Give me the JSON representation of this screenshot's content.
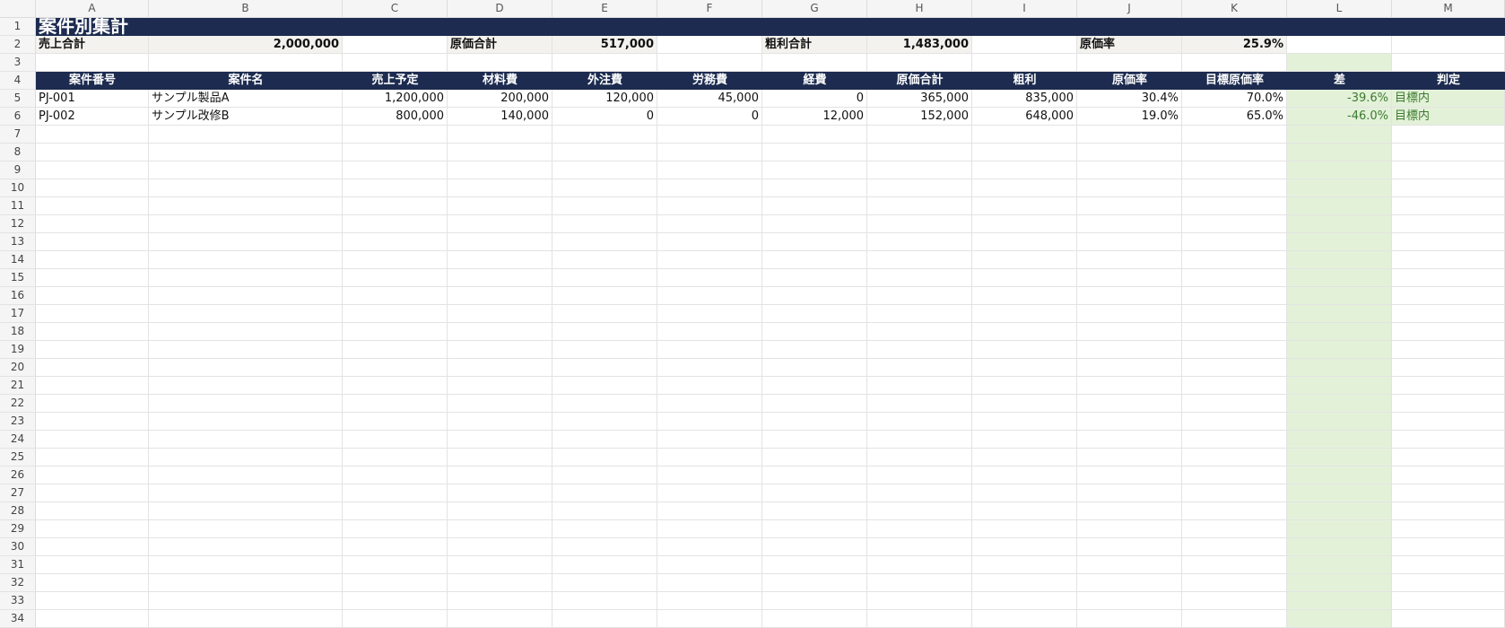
{
  "columns": [
    "A",
    "B",
    "C",
    "D",
    "E",
    "F",
    "G",
    "H",
    "I",
    "J",
    "K",
    "L",
    "M"
  ],
  "title": "案件別集計",
  "summary": {
    "sales_label": "売上合計",
    "sales_value": "2,000,000",
    "cost_label": "原価合計",
    "cost_value": "517,000",
    "profit_label": "粗利合計",
    "profit_value": "1,483,000",
    "rate_label": "原価率",
    "rate_value": "25.9%"
  },
  "headers": [
    "案件番号",
    "案件名",
    "売上予定",
    "材料費",
    "外注費",
    "労務費",
    "経費",
    "原価合計",
    "粗利",
    "原価率",
    "目標原価率",
    "差",
    "判定"
  ],
  "rows": [
    [
      "PJ-001",
      "サンプル製品A",
      "1,200,000",
      "200,000",
      "120,000",
      "45,000",
      "0",
      "365,000",
      "835,000",
      "30.4%",
      "70.0%",
      "-39.6%",
      "目標内"
    ],
    [
      "PJ-002",
      "サンプル改修B",
      "800,000",
      "140,000",
      "0",
      "0",
      "12,000",
      "152,000",
      "648,000",
      "19.0%",
      "65.0%",
      "-46.0%",
      "目標内"
    ]
  ],
  "row_count": 34,
  "colors": {
    "header_bg": "#1c2b4f",
    "summary_bg": "#f4f2ef",
    "highlight_green": "#e3f1d9",
    "green_text": "#3d7a2e"
  }
}
